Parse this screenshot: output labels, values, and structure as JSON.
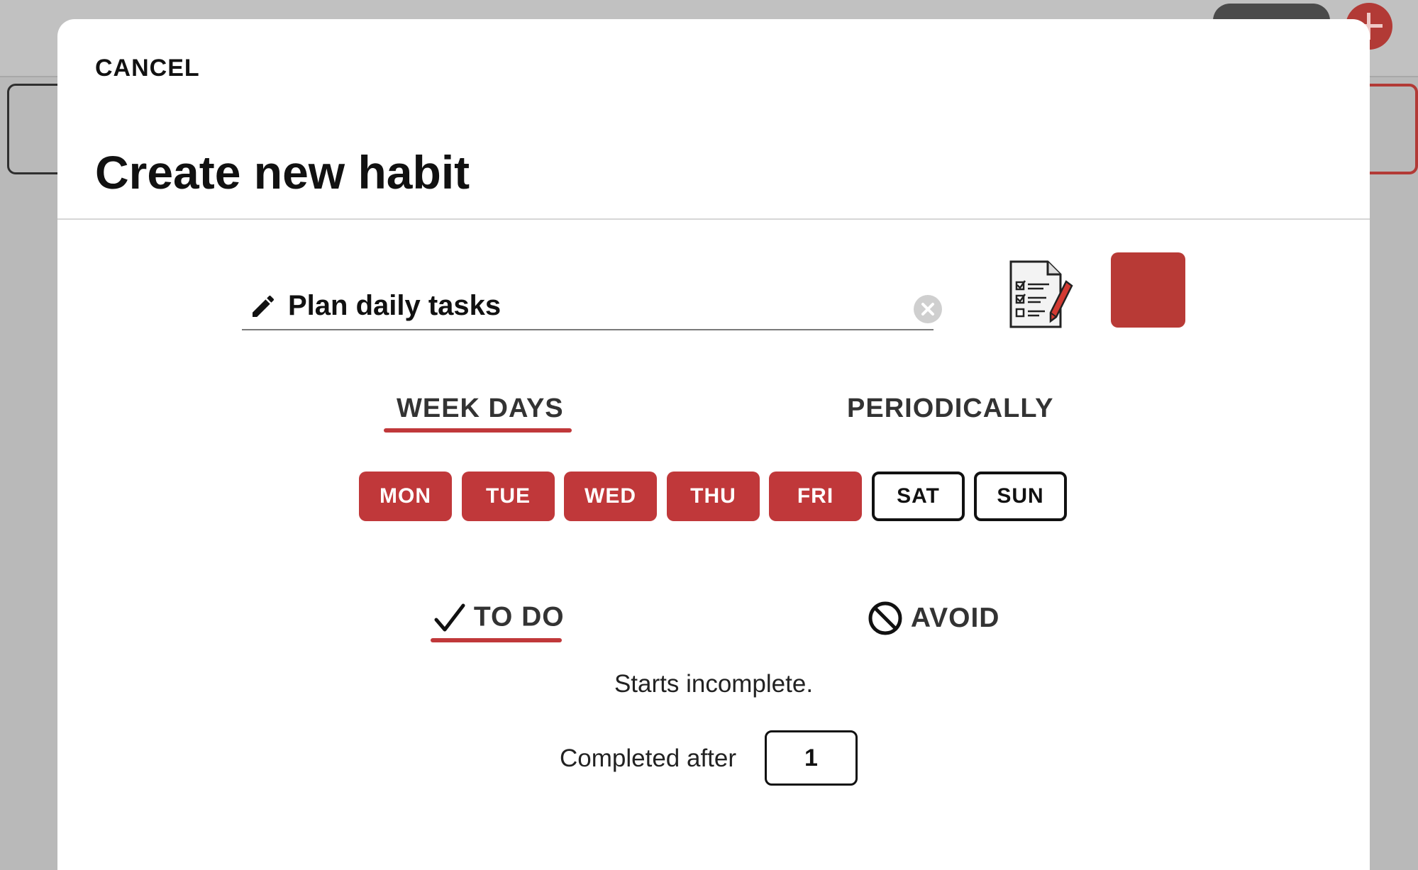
{
  "modal": {
    "cancel_label": "CANCEL",
    "title": "Create new habit"
  },
  "habit": {
    "name": "Plan daily tasks",
    "icon": "checklist-pencil-icon",
    "color": "#b83a36"
  },
  "schedule_tabs": {
    "items": [
      {
        "label": "WEEK DAYS",
        "selected": true
      },
      {
        "label": "PERIODICALLY",
        "selected": false
      }
    ]
  },
  "days": [
    {
      "label": "MON",
      "selected": true
    },
    {
      "label": "TUE",
      "selected": true
    },
    {
      "label": "WED",
      "selected": true
    },
    {
      "label": "THU",
      "selected": true
    },
    {
      "label": "FRI",
      "selected": true
    },
    {
      "label": "SAT",
      "selected": false
    },
    {
      "label": "SUN",
      "selected": false
    }
  ],
  "mode_tabs": {
    "items": [
      {
        "label": "TO DO",
        "icon": "checkmark-icon",
        "selected": true
      },
      {
        "label": "AVOID",
        "icon": "prohibited-icon",
        "selected": false
      }
    ]
  },
  "todo": {
    "starts_text": "Starts incomplete.",
    "completed_after_label": "Completed after",
    "completed_after_value": "1"
  },
  "accent_color": "#c0383a"
}
